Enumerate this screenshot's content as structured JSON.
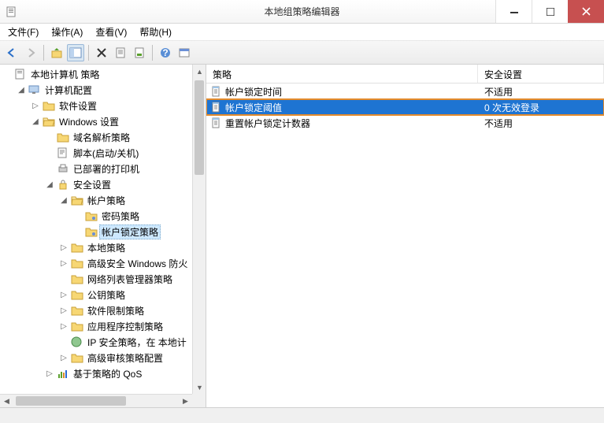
{
  "window": {
    "title": "本地组策略编辑器"
  },
  "menu": {
    "file": "文件(F)",
    "action": "操作(A)",
    "view": "查看(V)",
    "help": "帮助(H)"
  },
  "tree": {
    "root": "本地计算机 策略",
    "computer_config": "计算机配置",
    "software_settings": "软件设置",
    "windows_settings": "Windows 设置",
    "dns_policy": "域名解析策略",
    "scripts": "脚本(启动/关机)",
    "printers": "已部署的打印机",
    "security_settings": "安全设置",
    "account_policy": "帐户策略",
    "password_policy": "密码策略",
    "account_lockout_policy": "帐户锁定策略",
    "local_policy": "本地策略",
    "adv_firewall": "高级安全 Windows 防火",
    "nlm_policy": "网络列表管理器策略",
    "pubkey_policy": "公钥策略",
    "software_restrict": "软件限制策略",
    "app_control": "应用程序控制策略",
    "ip_security": "IP 安全策略，在 本地计",
    "adv_audit": "高级审核策略配置",
    "qos": "基于策略的 QoS"
  },
  "list": {
    "col_policy": "策略",
    "col_security": "安全设置",
    "rows": [
      {
        "name": "帐户锁定时间",
        "value": "不适用"
      },
      {
        "name": "帐户锁定阈值",
        "value": "0 次无效登录"
      },
      {
        "name": "重置帐户锁定计数器",
        "value": "不适用"
      }
    ],
    "selected_index": 1
  }
}
